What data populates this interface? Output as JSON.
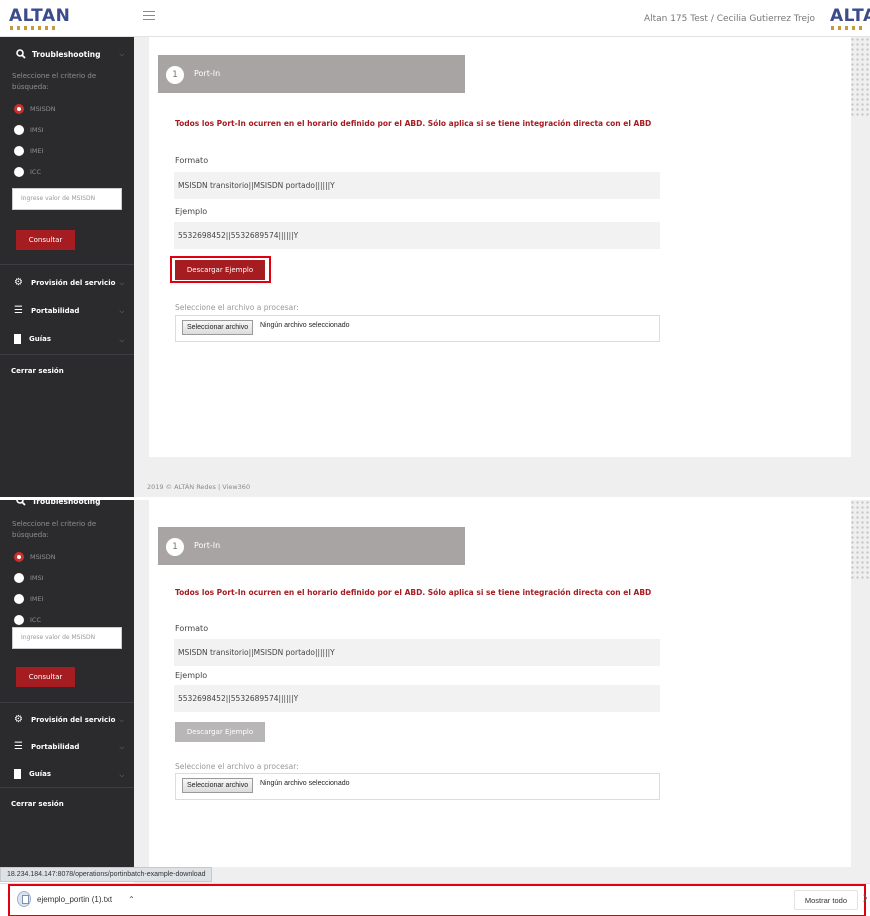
{
  "header": {
    "logo": "ALTAN",
    "user": "Altan 175 Test / Cecilia Gutierrez Trejo"
  },
  "sidebar": {
    "search_title": "Troubleshooting",
    "hint": "Seleccione el criterio de búsqueda:",
    "options": [
      "MSISDN",
      "IMSI",
      "IMEI",
      "ICC"
    ],
    "selected": "MSISDN",
    "input_placeholder": "Ingrese valor de MSISDN",
    "consult": "Consultar",
    "nav": [
      "Provisión del servicio",
      "Portabilidad",
      "Guías"
    ],
    "logout": "Cerrar sesión"
  },
  "main": {
    "step_number": "1",
    "step_title": "Port-In",
    "warning": "Todos los Port-In ocurren en el horario definido por el ABD. Sólo aplica si se tiene integración directa con el ABD",
    "format_label": "Formato",
    "format_value": "MSISDN transitorio||MSISDN portado||||||Y",
    "example_label": "Ejemplo",
    "example_value": "5532698452||5532689574||||||Y",
    "download_button": "Descargar Ejemplo",
    "file_label": "Seleccione el archivo a procesar:",
    "file_button": "Seleccionar archivo",
    "file_none": "Ningún archivo seleccionado",
    "footer": "2019 © ALTÁN Redes | View360"
  },
  "browser": {
    "status_url": "18.234.184.147:8078/operations/portinbatch-example-download",
    "download_file": "ejemplo_portin (1).txt",
    "show_all": "Mostrar todo"
  },
  "colors": {
    "accent": "#a51c21",
    "sidebar": "#2b2a2d",
    "step_header": "#a8a4a4",
    "highlight": "#e0000f",
    "button_disabled": "#b8b6b6"
  }
}
